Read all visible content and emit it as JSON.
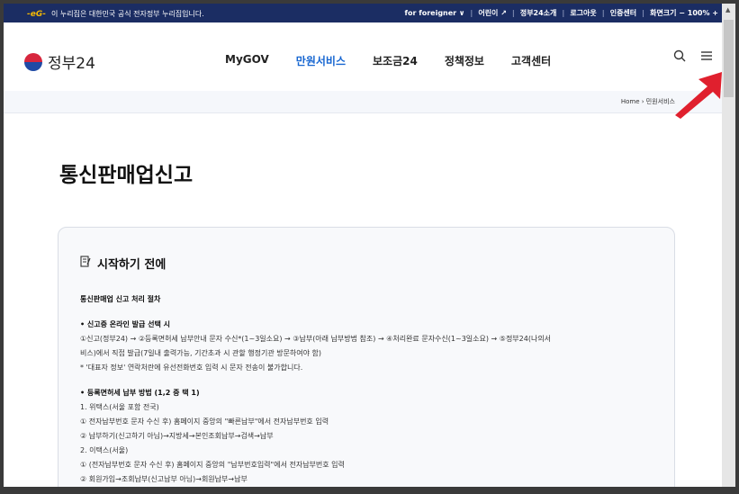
{
  "govbar": {
    "logo_text": "-eG-",
    "notice": "이 누리집은 대한민국 공식 전자정부 누리집입니다.",
    "links": [
      "for foreigner ∨",
      "어린이 ↗",
      "정부24소개",
      "로그아웃",
      "인증센터",
      "화면크기 − 100% +"
    ]
  },
  "header": {
    "brand": "정부24",
    "nav": [
      "MyGOV",
      "만원서비스",
      "보조금24",
      "정책정보",
      "고객센터"
    ],
    "active_index": 1,
    "search_icon": "search-icon",
    "menu_icon": "menu-icon"
  },
  "breadcrumb": {
    "home": "Home",
    "sep": "›",
    "current": "민원서비스"
  },
  "page": {
    "title": "통신판매업신고"
  },
  "infobox": {
    "heading": "시작하기 전에",
    "subheading": "통신판매업 신고 처리 절차",
    "section1": {
      "title": "• 신고증 온라인 발급 선택 시",
      "lines": [
        "①신고(정부24) → ②등록면허세 납부안내 문자 수신*(1~3일소요) → ③납부(아래 납부방법 참조) → ④처리완료 문자수신(1~3일소요) → ⑤정부24(나의서",
        "비스)에서 직접 발급(7일내 출력가능, 기간초과 시 관할 행정기관 방문하여야 함)",
        "* '대표자 정보' 연락처란에 유선전화번호 입력 시 문자 전송이 불가합니다."
      ]
    },
    "section2": {
      "title": "• 등록면허세 납부 방법 (1,2 중 택 1)",
      "lines": [
        "1. 위택스(서울 포함 전국)",
        "① 전자납부번호 문자 수신 후) 홈페이지 중앙의 \"빠른납부\"에서 전자납부번호 입력",
        "② 납부하기(신고하기 아님)→지방세→본인조회납부→검색→납부",
        "2. 이택스(서울)",
        "① (전자납부번호 문자 수신 후) 홈페이지 중앙의 \"납부번호입력\"에서 전자납부번호 입력",
        "② 회원가입→조회납부(신고납부 아님)→회원납부→납부"
      ]
    }
  },
  "colors": {
    "govbar": "#1b2d63",
    "active": "#1766d1",
    "arrow": "#e0202e"
  }
}
